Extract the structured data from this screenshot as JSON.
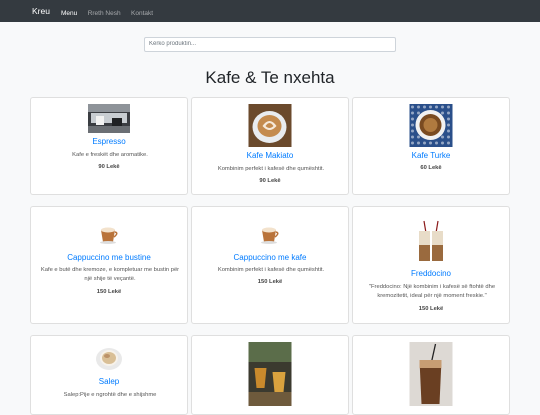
{
  "navbar": {
    "brand": "Kreu",
    "links": [
      "Menu",
      "Rreth Nesh",
      "Kontakt"
    ]
  },
  "search": {
    "placeholder": "Kërko produktin..."
  },
  "page_title": "Kafe & Te nxehta",
  "products": [
    {
      "name": "Espresso",
      "description": "Kafe e freskët dhe aromatike.",
      "price": "90 Lekë",
      "image": "espresso-machine-image"
    },
    {
      "name": "Kafe Makiato",
      "description": "Kombinim perfekt i kafesë dhe qumështit.",
      "price": "90 Lekë",
      "image": "latte-art-image"
    },
    {
      "name": "Kafe Turke",
      "description": "",
      "price": "60 Lekë",
      "image": "turkish-coffee-image"
    },
    {
      "name": "Cappuccino me bustine",
      "description": "Kafe e butë dhe kremoze, e kompletuar me bustin për një shije të veçantë.",
      "price": "150 Lekë",
      "image": "cappuccino-image"
    },
    {
      "name": "Cappuccino me kafe",
      "description": "Kombinim perfekt i kafesë dhe qumështit.",
      "price": "150 Lekë",
      "image": "cappuccino-image"
    },
    {
      "name": "Freddocino",
      "description": "\"Freddocino: Një kombinim i kafesë së ftohtë dhe kremozitetit, ideal për një moment freskie.\"",
      "price": "150 Lekë",
      "image": "iced-drinks-image"
    },
    {
      "name": "Salep",
      "description": "Salep:Pije e ngrohtë dhe e shijshme",
      "price": "",
      "image": "salep-cup-image"
    },
    {
      "name": "",
      "description": "",
      "price": "",
      "image": "tea-glasses-image"
    },
    {
      "name": "",
      "description": "",
      "price": "",
      "image": "iced-coffee-image"
    }
  ]
}
